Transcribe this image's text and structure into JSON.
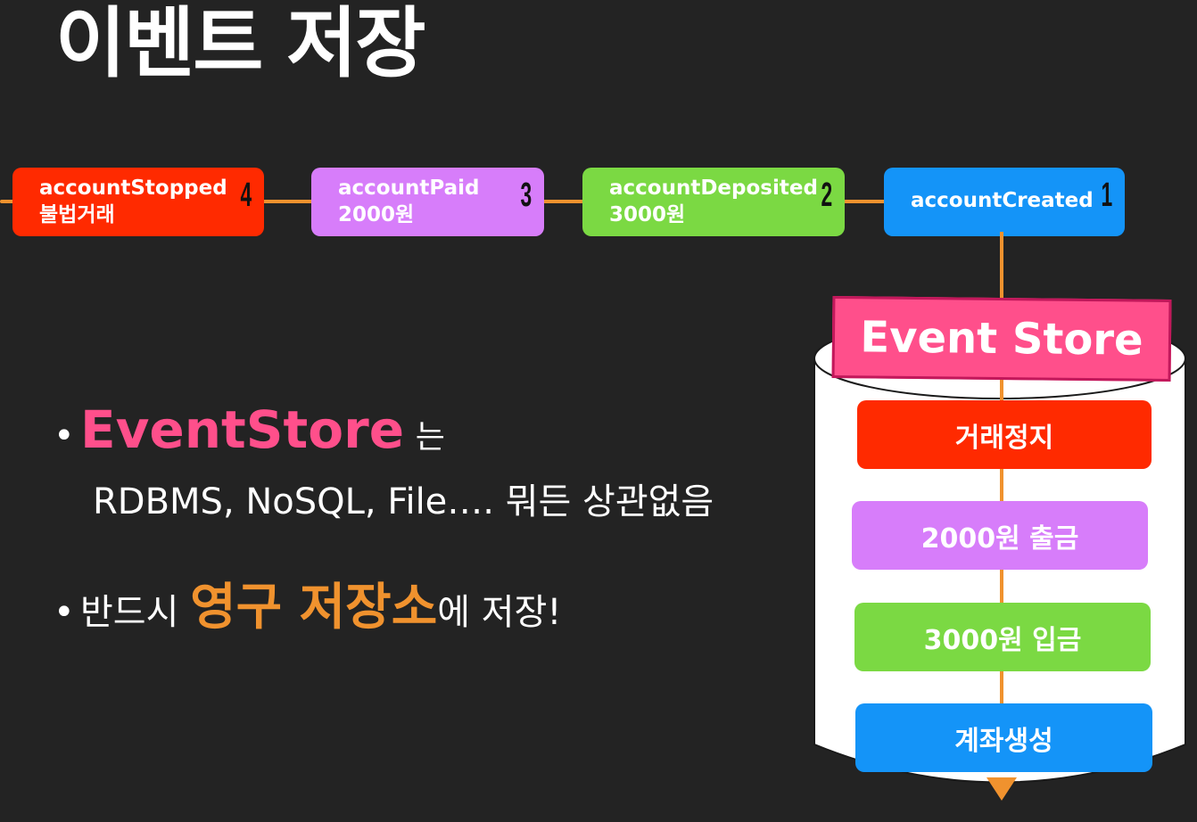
{
  "title": "이벤트 저장",
  "events": [
    {
      "id": "4",
      "line1": "accountStopped",
      "line2": "불법거래",
      "color": "#ff2a00"
    },
    {
      "id": "3",
      "line1": "accountPaid",
      "line2": "2000원",
      "color": "#d77dfa"
    },
    {
      "id": "2",
      "line1": "accountDeposited",
      "line2": "3000원",
      "color": "#7bd943"
    },
    {
      "id": "1",
      "line1": "accountCreated",
      "line2": "",
      "color": "#1494f8"
    }
  ],
  "bullets": {
    "first_highlight": "EventStore",
    "first_suffix": "는",
    "first_sub": "RDBMS, NoSQL, File…. 뭐든 상관없음",
    "second_prefix": "반드시",
    "second_highlight": "영구 저장소",
    "second_suffix": "에 저장!"
  },
  "event_store": {
    "label": "Event Store",
    "items": [
      "거래정지",
      "2000원 출금",
      "3000원 입금",
      "계좌생성"
    ]
  },
  "colors": {
    "background": "#232323",
    "arrow": "#f0922e",
    "highlight_pink": "#ff4f8b",
    "highlight_orange": "#f0922e"
  }
}
